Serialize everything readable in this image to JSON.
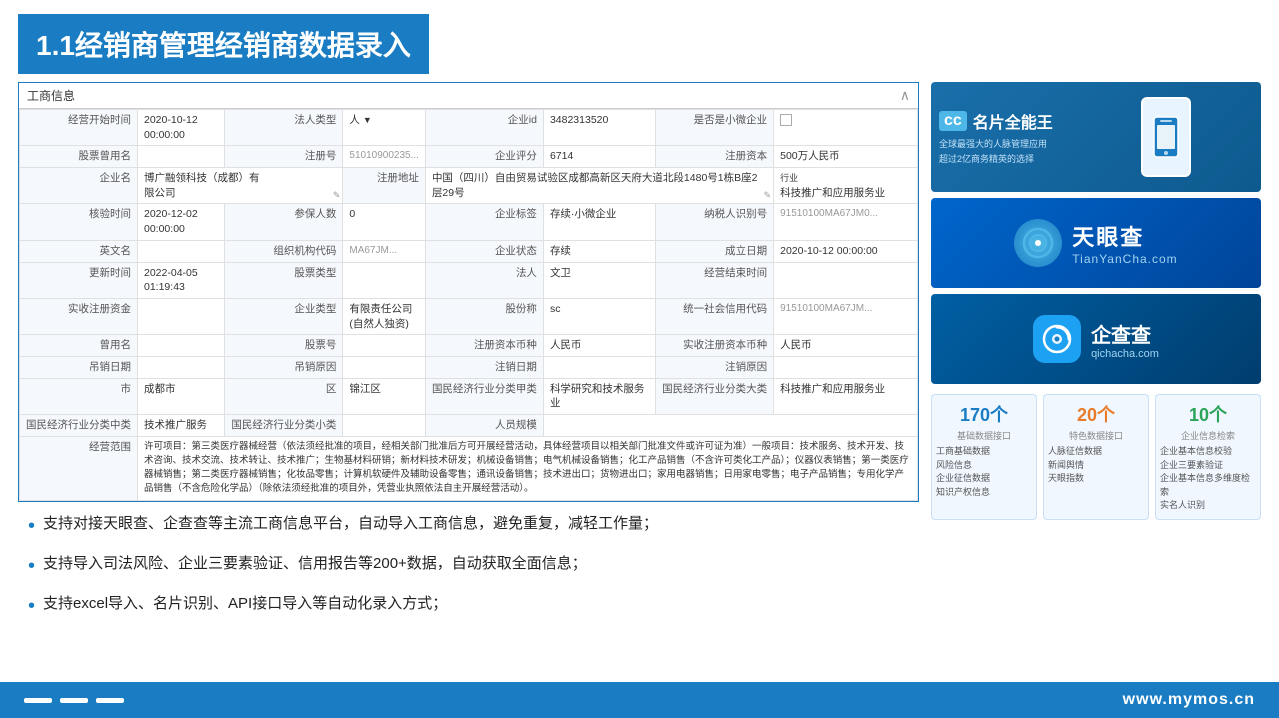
{
  "title": "1.1经销商管理经销商数据录入",
  "biz_card": {
    "header": "工商信息",
    "rows": [
      {
        "fields": [
          {
            "label": "经营开始时间",
            "value": "2020-10-12 00:00:00"
          },
          {
            "label": "法人类型",
            "value": "人",
            "type": "select"
          },
          {
            "label": "企业id",
            "value": "3482313520"
          },
          {
            "label": "是否是小微企业",
            "value": "checkbox"
          }
        ]
      },
      {
        "fields": [
          {
            "label": "股票曾用名",
            "value": ""
          },
          {
            "label": "注册号",
            "value": "51010900235..."
          },
          {
            "label": "企业评分",
            "value": "6714"
          },
          {
            "label": "注册资本",
            "value": "500万人民币"
          }
        ]
      },
      {
        "fields": [
          {
            "label": "企业名",
            "value": "博广融领科技（成都）有限公司",
            "type": "textarea"
          },
          {
            "label": "注册地址",
            "value": "中国（四川）自由贸易试验区成都高新区天府大道北段1480号1栋B座2层29号",
            "type": "textarea"
          },
          {
            "label": "行业",
            "value": "科技推广和应用服务业"
          }
        ]
      },
      {
        "fields": [
          {
            "label": "核验时间",
            "value": "2020-12-02 00:00:00"
          },
          {
            "label": "参保人数",
            "value": "0"
          },
          {
            "label": "企业标签",
            "value": "存续·小微企业"
          },
          {
            "label": "纳税人识别号",
            "value": "91510100MA67JM0..."
          }
        ]
      },
      {
        "fields": [
          {
            "label": "英文名",
            "value": ""
          },
          {
            "label": "组织机构代码",
            "value": "MA67JM..."
          },
          {
            "label": "企业状态",
            "value": "存续"
          },
          {
            "label": "成立日期",
            "value": "2020-10-12 00:00:00"
          }
        ]
      },
      {
        "fields": [
          {
            "label": "更新时间",
            "value": "2022-04-05 01:19:43"
          },
          {
            "label": "股票类型",
            "value": ""
          },
          {
            "label": "法人",
            "value": "文卫"
          },
          {
            "label": "经营结束时间",
            "value": ""
          }
        ]
      },
      {
        "fields": [
          {
            "label": "实收注册资金",
            "value": ""
          },
          {
            "label": "企业类型",
            "value": "有限责任公司(自然人独资)"
          },
          {
            "label": "股份称",
            "value": "sc"
          },
          {
            "label": "统一社会信用代码",
            "value": "91510100MA67JM..."
          }
        ]
      },
      {
        "fields": [
          {
            "label": "曾用名",
            "value": ""
          },
          {
            "label": "股票号",
            "value": ""
          },
          {
            "label": "注册资本币种",
            "value": "人民币"
          },
          {
            "label": "实收注册资本币种",
            "value": "人民币"
          }
        ]
      },
      {
        "fields": [
          {
            "label": "吊销日期",
            "value": ""
          },
          {
            "label": "吊销原因",
            "value": ""
          },
          {
            "label": "注销日期",
            "value": ""
          },
          {
            "label": "注销原因",
            "value": ""
          }
        ]
      },
      {
        "fields": [
          {
            "label": "市",
            "value": "成都市"
          },
          {
            "label": "区",
            "value": "锦江区"
          },
          {
            "label": "国民经济行业分类甲类",
            "value": "科学研究和技术服务业"
          },
          {
            "label": "国民经济行业分类大类",
            "value": "科技推广和应用服务业"
          }
        ]
      },
      {
        "fields": [
          {
            "label": "国民经济行业分类中类",
            "value": "技术推广服务"
          },
          {
            "label": "国民经济行业分类小类",
            "value": ""
          },
          {
            "label": "人员规模",
            "value": ""
          }
        ]
      }
    ],
    "jingying_text": "许可项目：第三类医疗器械经营（依法须经批准的项目，经相关部门批准后方可开展经营活动，具体经营项目以相关部门批准文件或许可证为准）一般项目：技术服务、技术开发、技术咨询、技术交流、技术转让、技术推广；生物基材料研销；新材料技术研发；机械设备销售；电气机械设备销售；化工产品销售（不含许可类化工产品）；仪器仪表销售；第一类医疗器械销售；第二类医疗器械销售；化妆品零售；计算机软硬件及辅助设备零售；通讯设备销售；技术进出口；货物进出口；家用电器销售；日用家电零售；电子产品销售；专用化学产品销售（不含危险化学品）（除依法须经批准的项目外，凭营业执照依法自主开展经营活动）。"
  },
  "bullets": [
    "支持对接天眼查、企查查等主流工商信息平台，自动导入工商信息，避免重复，减轻工作量；",
    "支持导入司法风险、企业三要素验证、信用报告等200+数据，自动获取全面信息；",
    "支持excel导入、名片识别、API接口导入等自动化录入方式；"
  ],
  "right_panel": {
    "mingpian": {
      "badge": "cc",
      "title": "名片全能王",
      "subtitle1": "全球最强大的人脉管理应用",
      "subtitle2": "超过2亿商务精英的选择"
    },
    "tianyanzha": {
      "name": "天眼查",
      "url": "TianYanCha.com"
    },
    "qichacha": {
      "name": "企查查",
      "url": "qichacha.com"
    },
    "stats": {
      "box1": {
        "num": "170个",
        "label": "基础数据接口",
        "items": [
          "工商基础数据",
          "风险信息",
          "企业征信数据",
          "知识产权信息"
        ]
      },
      "box2": {
        "num": "20个",
        "label": "特色数据接口",
        "items": [
          "人脉征信数据",
          "新闻舆情",
          "天眼指数"
        ]
      },
      "box3": {
        "num": "10个",
        "label": "企业信息检索",
        "items": [
          "企业基本信息校验",
          "企业三要素验证",
          "企业基本信息多维度检索",
          "实名人识别"
        ]
      }
    }
  },
  "footer": {
    "url": "www.mymos.cn"
  }
}
